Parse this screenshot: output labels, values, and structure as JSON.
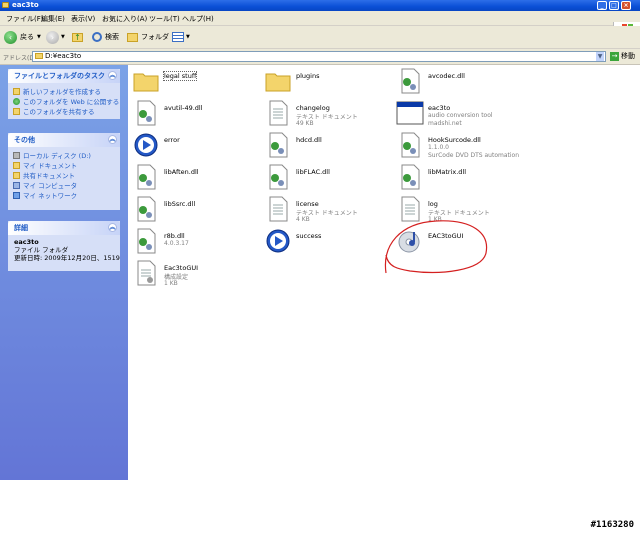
{
  "window": {
    "title": "eac3to"
  },
  "menu": [
    "ファイル(F)",
    "編集(E)",
    "表示(V)",
    "お気に入り(A)",
    "ツール(T)",
    "ヘルプ(H)"
  ],
  "toolbar": {
    "back_label": "戻る",
    "search_label": "検索",
    "folders_label": "フォルダ"
  },
  "address": {
    "label": "アドレス(D)",
    "value": "D:¥eac3to",
    "go_label": "移動"
  },
  "sidebar": {
    "tasks": {
      "title": "ファイルとフォルダのタスク",
      "items": [
        "新しいフォルダを作成する",
        "このフォルダを Web に公開する",
        "このフォルダを共有する"
      ]
    },
    "other": {
      "title": "その他",
      "items": [
        "ローカル ディスク (D:)",
        "マイ ドキュメント",
        "共有ドキュメント",
        "マイ コンピュータ",
        "マイ ネットワーク"
      ]
    },
    "details": {
      "title": "詳細",
      "name": "eac3to",
      "type": "ファイル フォルダ",
      "modified": "更新日時: 2009年12月20日、1519"
    }
  },
  "files": [
    {
      "name": "legal stuff",
      "sub1": "",
      "sub2": "",
      "icon": "folder-icon"
    },
    {
      "name": "plugins",
      "sub1": "",
      "sub2": "",
      "icon": "folder-icon"
    },
    {
      "name": "avcodec.dll",
      "sub1": "",
      "sub2": "",
      "icon": "dll-icon"
    },
    {
      "name": "avutil-49.dll",
      "sub1": "",
      "sub2": "",
      "icon": "dll-icon"
    },
    {
      "name": "changelog",
      "sub1": "テキスト ドキュメント",
      "sub2": "49 KB",
      "icon": "text-document-icon"
    },
    {
      "name": "eac3to",
      "sub1": "audio conversion tool",
      "sub2": "madshi.net",
      "icon": "exe-window-icon"
    },
    {
      "name": "error",
      "sub1": "",
      "sub2": "",
      "icon": "media-player-icon"
    },
    {
      "name": "hdcd.dll",
      "sub1": "",
      "sub2": "",
      "icon": "dll-icon"
    },
    {
      "name": "HookSurcode.dll",
      "sub1": "1.1.0.0",
      "sub2": "SurCode DVD DTS automation",
      "icon": "dll-icon"
    },
    {
      "name": "libAften.dll",
      "sub1": "",
      "sub2": "",
      "icon": "dll-icon"
    },
    {
      "name": "libFLAC.dll",
      "sub1": "",
      "sub2": "",
      "icon": "dll-icon"
    },
    {
      "name": "libMatrix.dll",
      "sub1": "",
      "sub2": "",
      "icon": "dll-icon"
    },
    {
      "name": "libSsrc.dll",
      "sub1": "",
      "sub2": "",
      "icon": "dll-icon"
    },
    {
      "name": "license",
      "sub1": "テキスト ドキュメント",
      "sub2": "4 KB",
      "icon": "text-document-icon"
    },
    {
      "name": "log",
      "sub1": "テキスト ドキュメント",
      "sub2": "1 KB",
      "icon": "text-document-icon"
    },
    {
      "name": "r8b.dll",
      "sub1": "4.0.3.17",
      "sub2": "",
      "icon": "dll-icon"
    },
    {
      "name": "success",
      "sub1": "",
      "sub2": "",
      "icon": "media-player-icon"
    },
    {
      "name": "EAC3toGUI",
      "sub1": "",
      "sub2": "",
      "icon": "cd-audio-icon"
    },
    {
      "name": "Eac3toGUI",
      "sub1": "構成設定",
      "sub2": "1 KB",
      "icon": "config-file-icon"
    }
  ],
  "watermark": "#1163280",
  "colors": {
    "title_blue": "#0a4fd6",
    "sidebar_blue": "#6f8fe0",
    "annotation_red": "#d42020"
  }
}
